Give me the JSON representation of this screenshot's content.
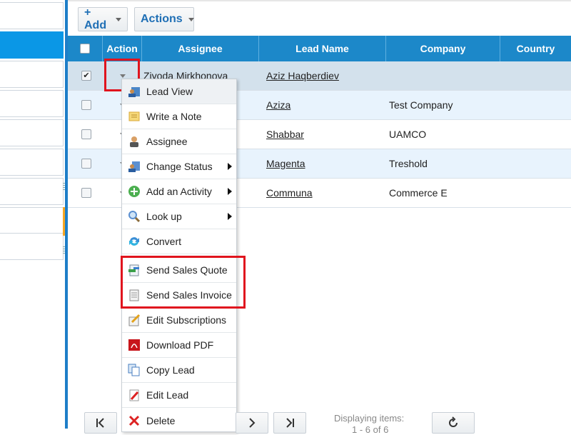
{
  "toolbar": {
    "add_label": "+ Add",
    "actions_label": "Actions"
  },
  "grid": {
    "columns": [
      "Action",
      "Assignee",
      "Lead Name",
      "Company",
      "Country"
    ],
    "rows": [
      {
        "checked": true,
        "assignee": "Ziyoda Mirkhonova",
        "lead_name": "Aziz Haqberdiev",
        "company": "",
        "country": ""
      },
      {
        "checked": false,
        "assignee": "",
        "lead_name": "Aziza",
        "company": "Test Company",
        "country": ""
      },
      {
        "checked": false,
        "assignee": "",
        "lead_name": "Shabbar",
        "company": "UAMCO",
        "country": ""
      },
      {
        "checked": false,
        "assignee": "",
        "lead_name": "Magenta",
        "company": "Treshold",
        "country": ""
      },
      {
        "checked": false,
        "assignee": "",
        "lead_name": "Communa",
        "company": "Commerce E",
        "country": ""
      }
    ]
  },
  "context_menu": {
    "items": [
      {
        "label": "Lead View",
        "icon": "lead-view-icon",
        "submenu": false
      },
      {
        "label": "Write a Note",
        "icon": "note-icon",
        "submenu": false
      },
      {
        "label": "Assignee",
        "icon": "assignee-icon",
        "submenu": false
      },
      {
        "label": "Change Status",
        "icon": "change-status-icon",
        "submenu": true
      },
      {
        "label": "Add an Activity",
        "icon": "add-activity-icon",
        "submenu": true
      },
      {
        "label": "Look up",
        "icon": "magnifier-icon",
        "submenu": true
      },
      {
        "label": "Convert",
        "icon": "convert-icon",
        "submenu": false
      },
      {
        "label": "Send Sales Quote",
        "icon": "sales-quote-icon",
        "submenu": false
      },
      {
        "label": "Send Sales Invoice",
        "icon": "sales-invoice-icon",
        "submenu": false
      },
      {
        "label": "Edit Subscriptions",
        "icon": "edit-subscriptions-icon",
        "submenu": false
      },
      {
        "label": "Download PDF",
        "icon": "pdf-icon",
        "submenu": false
      },
      {
        "label": "Copy Lead",
        "icon": "copy-icon",
        "submenu": false
      },
      {
        "label": "Edit Lead",
        "icon": "edit-icon",
        "submenu": false
      },
      {
        "label": "Delete",
        "icon": "delete-icon",
        "submenu": false
      }
    ]
  },
  "pager": {
    "display_text": "Displaying items:",
    "display_count": "1 - 6 of 6"
  },
  "colors": {
    "header": "#1c88c9",
    "sidebar_active": "#0a97e6",
    "annotation": "#e0141e"
  }
}
